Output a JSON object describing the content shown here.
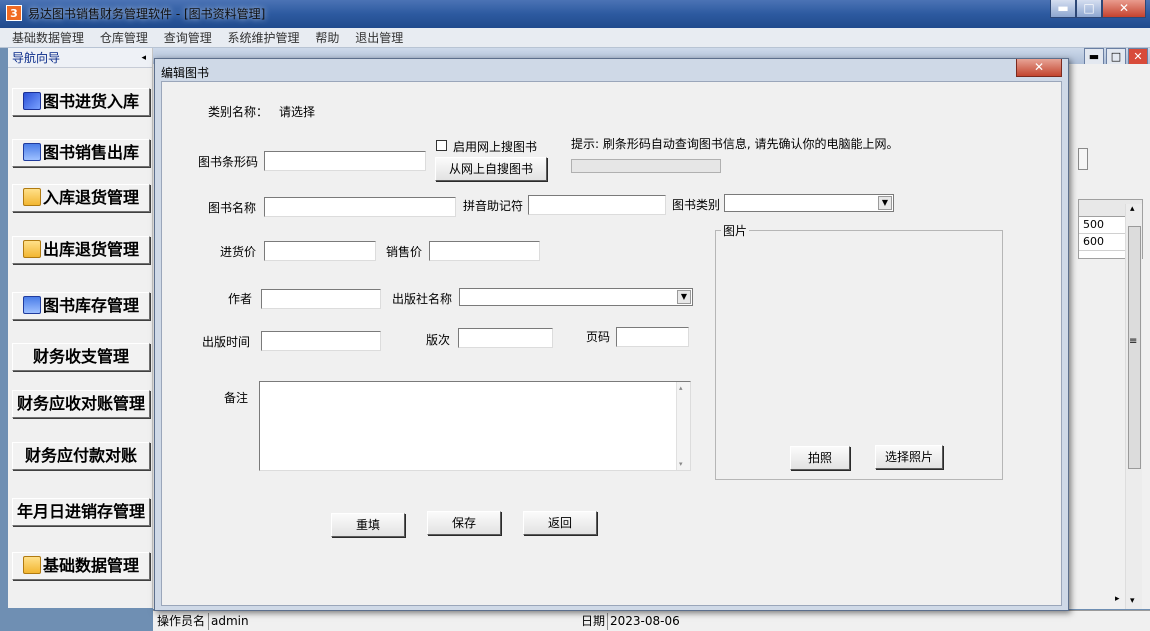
{
  "window": {
    "title": "易达图书销售财务管理软件     - [图书资料管理]",
    "icon_char": "3",
    "min": "▬",
    "max": "□",
    "close": "✕"
  },
  "menu": [
    "基础数据管理",
    "仓库管理",
    "查询管理",
    "系统维护管理",
    "帮助",
    "退出管理"
  ],
  "nav": {
    "title": "导航向导",
    "arrow": "◂",
    "items": [
      {
        "label": "图书进货入库",
        "icon": "book-icon"
      },
      {
        "label": "图书销售出库",
        "icon": "arrow-icon"
      },
      {
        "label": "入库退货管理",
        "icon": "folder-icon"
      },
      {
        "label": "出库退货管理",
        "icon": "folder-icon"
      },
      {
        "label": "图书库存管理",
        "icon": "arrow-icon"
      },
      {
        "label": "财务收支管理",
        "icon": ""
      },
      {
        "label": "财务应收对账管理",
        "icon": ""
      },
      {
        "label": "财务应付款对账",
        "icon": ""
      },
      {
        "label": "年月日进销存管理",
        "icon": ""
      },
      {
        "label": "基础数据管理",
        "icon": "folder-icon"
      }
    ]
  },
  "background": {
    "grid_values": [
      "500",
      "600"
    ],
    "scroll_up": "▴",
    "scroll_down": "▾",
    "scroll_grip": "≡",
    "scroll_right": "▸"
  },
  "status": {
    "operator_label": "操作员名",
    "operator_value": "admin",
    "date_label": "日期",
    "date_value": "2023-08-06"
  },
  "dialog": {
    "title": "编辑图书",
    "close": "✕",
    "category_label": "类别名称：",
    "category_value": "请选择",
    "barcode_label": "图书条形码",
    "barcode_value": "",
    "web_search_checkbox": "启用网上搜图书",
    "web_search_button": "从网上自搜图书",
    "hint": "提示: 刷条形码自动查询图书信息, 请先确认你的电脑能上网。",
    "name_label": "图书名称",
    "name_value": "",
    "pinyin_label": "拼音助记符",
    "pinyin_value": "",
    "type_label": "图书类别",
    "type_value": "",
    "purchase_price_label": "进货价",
    "purchase_price_value": "",
    "sale_price_label": "销售价",
    "sale_price_value": "",
    "author_label": "作者",
    "author_value": "",
    "publisher_label": "出版社名称",
    "publisher_value": "",
    "publish_date_label": "出版时间",
    "publish_date_value": "",
    "edition_label": "版次",
    "edition_value": "",
    "pages_label": "页码",
    "pages_value": "",
    "remark_label": "备注",
    "remark_value": "",
    "photo_group": "图片",
    "take_photo_button": "拍照",
    "choose_photo_button": "选择照片",
    "reset_button": "重填",
    "save_button": "保存",
    "back_button": "返回",
    "dropdown_arrow": "▼"
  }
}
